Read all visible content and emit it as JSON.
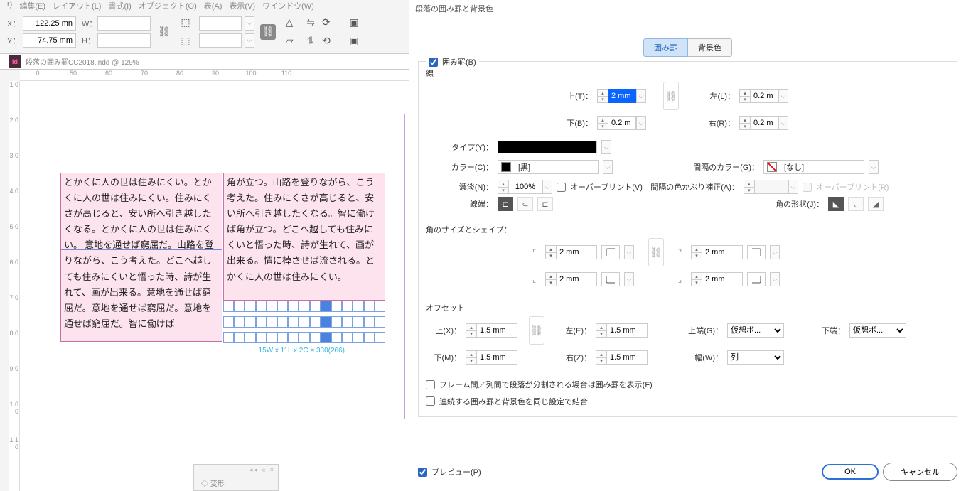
{
  "menubar": [
    "r)",
    "編集(E)",
    "レイアウト(L)",
    "書式(I)",
    "オブジェクト(O)",
    "表(A)",
    "表示(V)",
    "ワインドウ(W)"
  ],
  "toolbar": {
    "x_label": "X：",
    "x_value": "122.25 mn",
    "y_label": "Y：",
    "y_value": "74.75 mm",
    "w_label": "W：",
    "h_label": "H："
  },
  "doc_tab": "段落の囲み罫CC2018.indd @ 129%",
  "app_icon": "Id",
  "ruler_h": [
    "0",
    "50",
    "60",
    "70",
    "80",
    "90",
    "100",
    "110"
  ],
  "ruler_v": [
    "1 0",
    "2 0",
    "3 0",
    "4 0",
    "5 0",
    "6 0",
    "7 0",
    "8 0",
    "9 0",
    "1 0 0",
    "1 1 0"
  ],
  "body_col1_a": "とかくに人の世は住みにくい。とかくに人の世は住みにくい。住みにくさが高じると、安い所へ引き越したくなる。とかくに人の世は住みにくい。",
  "body_col1_b": "意地を通せば窮屈だ。山路を登りながら、こう考えた。どこへ越しても住みにくいと悟った時、詩が生れて、画が出来る。意地を通せば窮屈だ。意地を通せば窮屈だ。意地を通せば窮屈だ。智に働けば",
  "body_col2": "角が立つ。山路を登りながら、こう考えた。住みにくさが高じると、安い所へ引き越したくなる。智に働けば角が立つ。どこへ越しても住みにくいと悟った時、詩が生れて、画が出来る。情に棹させば流される。とかくに人の世は住みにくい。",
  "dim_label": "15W x 11L x 2C = 330(266)",
  "float_panel": "◇ 変形",
  "dialog": {
    "title": "段落の囲み罫と背景色",
    "tab_border": "囲み罫",
    "tab_bg": "背景色",
    "enable": "囲み罫(B)",
    "stroke_section": "線",
    "top": "上(T)：",
    "top_v": "2 mm",
    "bottom": "下(B)：",
    "bottom_v": "0.2 m",
    "left": "左(L)：",
    "left_v": "0.2 m",
    "right": "右(R)：",
    "right_v": "0.2 m",
    "type": "タイプ(Y)：",
    "color": "カラー(C)：",
    "color_v": "[黒]",
    "gap_color": "間隔のカラー(G)：",
    "gap_color_v": "[なし]",
    "tint": "濃淡(N)：",
    "tint_v": "100%",
    "overprint": "オーバープリント(V)",
    "gap_tint": "間隔の色かぶり補正(A)：",
    "overprint_r": "オーバープリント(R)",
    "cap": "線端：",
    "join": "角の形状(J)：",
    "corner_section": "角のサイズとシェイプ：",
    "corner_v": "2 mm",
    "offset_section": "オフセット",
    "off_top": "上(X)：",
    "off_top_v": "1.5 mm",
    "off_bottom": "下(M)：",
    "off_bottom_v": "1.5 mm",
    "off_left": "左(E)：",
    "off_left_v": "1.5 mm",
    "off_right": "右(Z)：",
    "off_right_v": "1.5 mm",
    "topedge": "上端(G)：",
    "topedge_v": "仮想ボ...",
    "bottomedge": "下端：",
    "bottomedge_v": "仮想ボ...",
    "width": "幅(W)：",
    "width_v": "列",
    "split": "フレーム間／列間で段落が分割される場合は囲み罫を表示(F)",
    "merge": "連続する囲み罫と背景色を同じ設定で結合",
    "preview": "プレビュー(P)",
    "ok": "OK",
    "cancel": "キャンセル"
  }
}
